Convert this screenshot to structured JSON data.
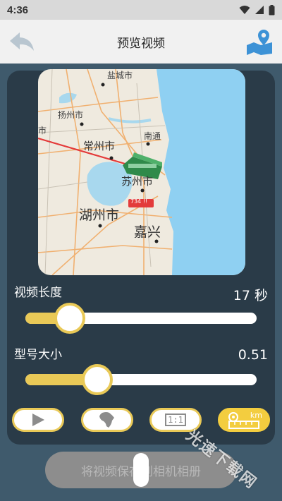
{
  "status": {
    "time": "4:36"
  },
  "header": {
    "title": "预览视频"
  },
  "map": {
    "place_labels": [
      "盐城市",
      "扬州市",
      "常州市",
      "南通",
      "苏州市",
      "湖州市",
      "嘉兴",
      "市"
    ],
    "road_badge": "734 !!"
  },
  "video_length": {
    "label": "视频长度",
    "value_text": "17 秒",
    "fraction": 0.16
  },
  "model_size": {
    "label": "型号大小",
    "value_text": "0.51",
    "fraction": 0.29
  },
  "tools": {
    "play_icon": "play-icon",
    "africa_icon": "africa-map-icon",
    "ratio_label": "1:1",
    "scale_label": "km"
  },
  "save_button": {
    "label": "将视频保存到相机相册"
  },
  "watermark": "光速下载网",
  "colors": {
    "accent": "#e9c957",
    "panel": "#2a3b48",
    "background": "#3f5a6c"
  }
}
